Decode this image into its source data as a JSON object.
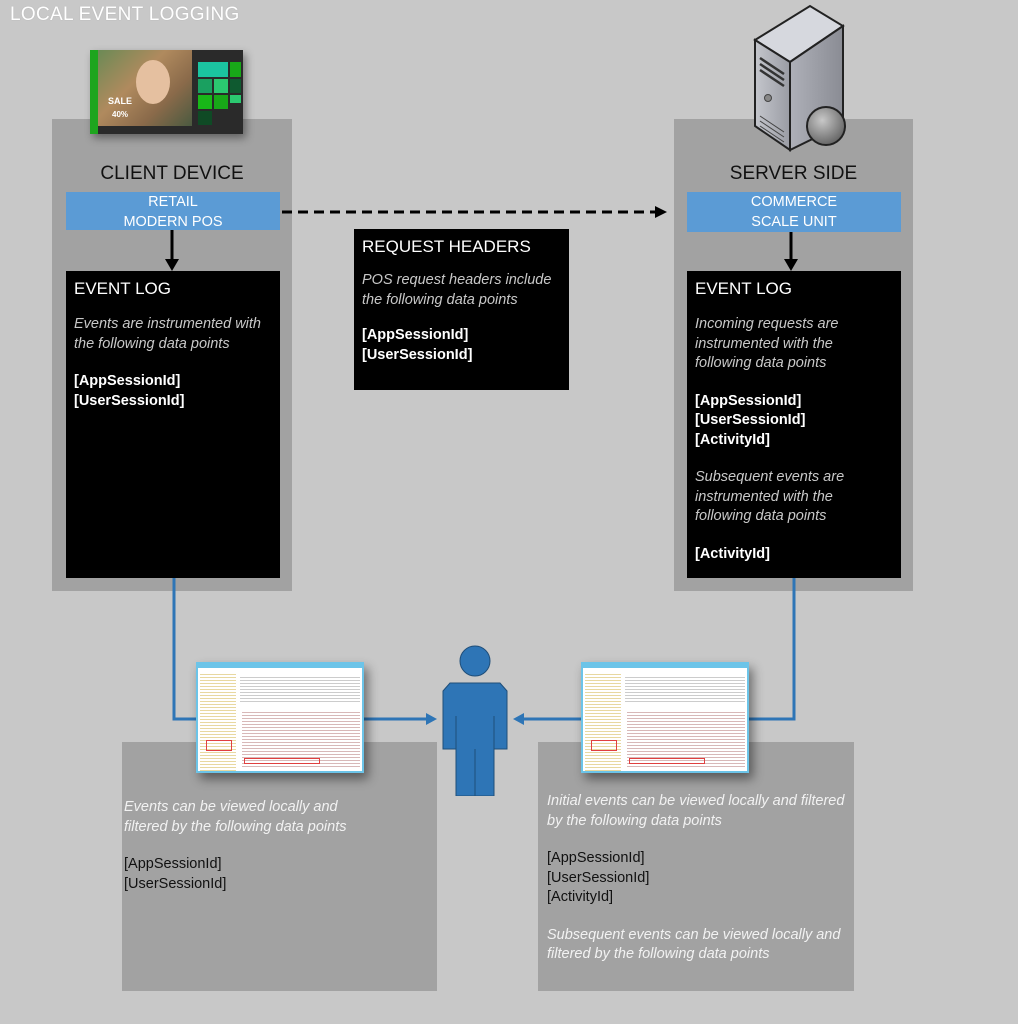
{
  "title": "LOCAL EVENT LOGGING",
  "client": {
    "heading": "CLIENT DEVICE",
    "app_line1": "RETAIL",
    "app_line2": "MODERN POS",
    "device_image": {
      "icon": "pos-tablet-screenshot",
      "sale_label": "SALE",
      "discount_label": "40%"
    },
    "event_log": {
      "title": "EVENT LOG",
      "description": "Events are instrumented with the following data points",
      "ids": [
        "[AppSessionId]",
        "[UserSessionId]"
      ]
    }
  },
  "request_headers": {
    "title": "REQUEST HEADERS",
    "description": "POS request headers include the following data points",
    "ids": [
      "[AppSessionId]",
      "[UserSessionId]"
    ]
  },
  "server": {
    "heading": "SERVER SIDE",
    "app_line1": "COMMERCE",
    "app_line2": "SCALE UNIT",
    "server_icon": "server-globe-icon",
    "event_log": {
      "title": "EVENT LOG",
      "description1": "Incoming requests are instrumented with the following data points",
      "ids1": [
        "[AppSessionId]",
        "[UserSessionId]",
        "[ActivityId]"
      ],
      "description2": "Subsequent events are instrumented with the following data points",
      "ids2": [
        "[ActivityId]"
      ]
    }
  },
  "client_viewer": {
    "icon": "event-viewer-screenshot",
    "description": "Events can be viewed locally and filtered by the following data points",
    "ids": [
      "[AppSessionId]",
      "[UserSessionId]"
    ]
  },
  "server_viewer": {
    "icon": "event-viewer-screenshot",
    "description1": "Initial events can be viewed locally and filtered by the following data points",
    "ids": [
      "[AppSessionId]",
      "[UserSessionId]",
      "[ActivityId]"
    ],
    "description2": "Subsequent events can be viewed locally and filtered by the following data points"
  },
  "user_icon": "person-icon",
  "colors": {
    "background": "#c8c8c8",
    "panel": "#a2a2a2",
    "accent_blue": "#5b9bd5",
    "connector_blue": "#2e75b6",
    "box_black": "#000000"
  }
}
